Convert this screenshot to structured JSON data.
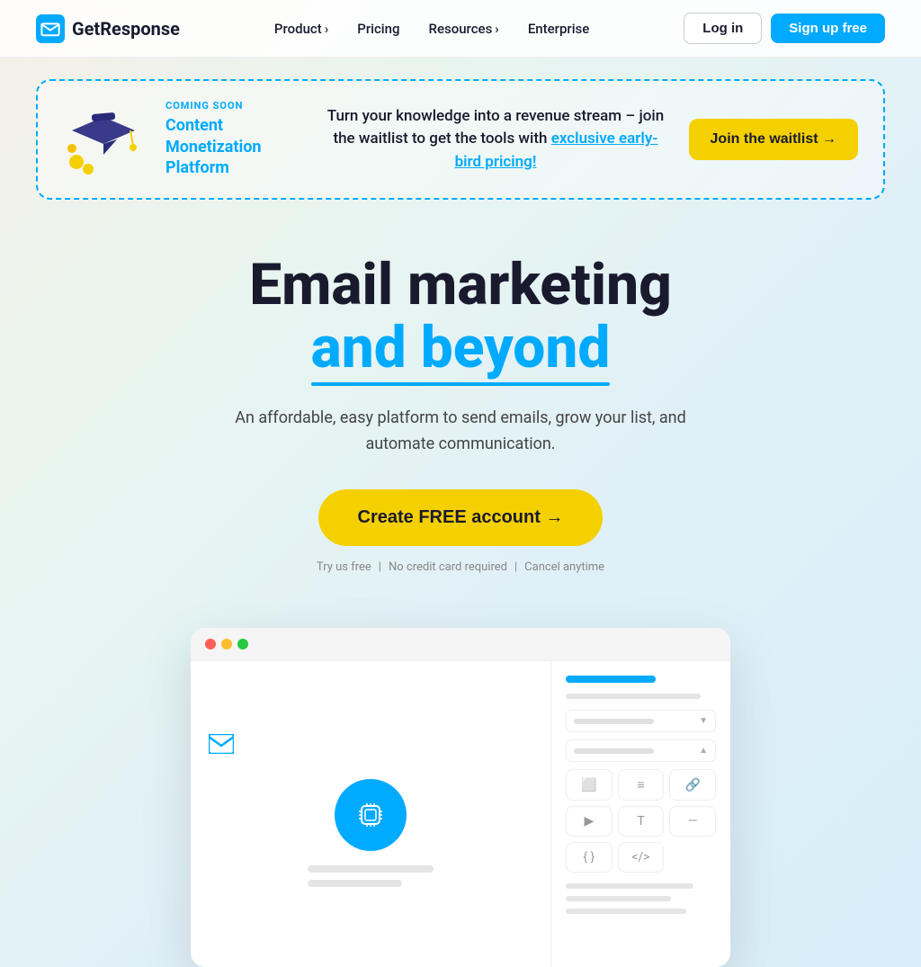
{
  "nav": {
    "logo_text": "GetResponse",
    "links": [
      {
        "label": "Product",
        "has_arrow": true
      },
      {
        "label": "Pricing",
        "has_arrow": false
      },
      {
        "label": "Resources",
        "has_arrow": true
      },
      {
        "label": "Enterprise",
        "has_arrow": false
      }
    ],
    "login_label": "Log in",
    "signup_label": "Sign up free"
  },
  "banner": {
    "coming_soon": "COMING SOON",
    "platform_name": "Content\nMonetization\nPlatform",
    "description_plain": "Turn your knowledge into a revenue stream – join the waitlist to get the tools with ",
    "description_link": "exclusive early-bird pricing!",
    "waitlist_label": "Join the waitlist →"
  },
  "hero": {
    "title_line1": "Email marketing",
    "title_line2": "and beyond",
    "subtitle": "An affordable, easy platform to send emails, grow your list, and automate communication.",
    "cta_label": "Create FREE account →",
    "note_parts": [
      "Try us free",
      "No credit card required",
      "Cancel anytime"
    ]
  },
  "mockup": {
    "dots": [
      "red",
      "yellow",
      "green"
    ]
  }
}
